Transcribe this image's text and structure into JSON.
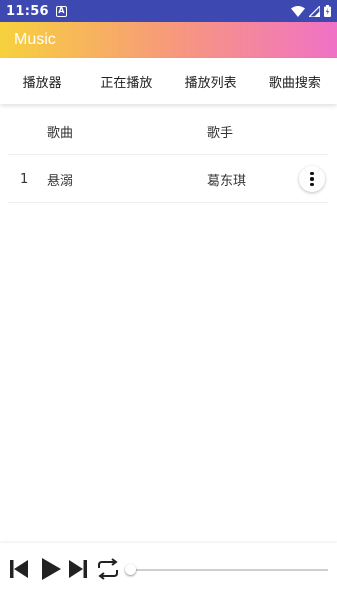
{
  "status_bar": {
    "time": "11:56",
    "notification_glyph": "A"
  },
  "app_bar": {
    "title": "Music"
  },
  "tabs": [
    {
      "label": "播放器"
    },
    {
      "label": "正在播放"
    },
    {
      "label": "播放列表"
    },
    {
      "label": "歌曲搜索"
    }
  ],
  "list": {
    "headers": {
      "song": "歌曲",
      "artist": "歌手"
    },
    "rows": [
      {
        "index": "1",
        "song": "悬溺",
        "artist": "葛东琪"
      }
    ]
  },
  "player": {
    "progress": 0,
    "icons": [
      "skip-previous-icon",
      "play-icon",
      "skip-next-icon",
      "repeat-icon"
    ]
  },
  "colors": {
    "status_bar": "#3d48b0",
    "gradient_start": "#f7d13d",
    "gradient_mid": "#f79a7a",
    "gradient_end": "#f071c6"
  }
}
